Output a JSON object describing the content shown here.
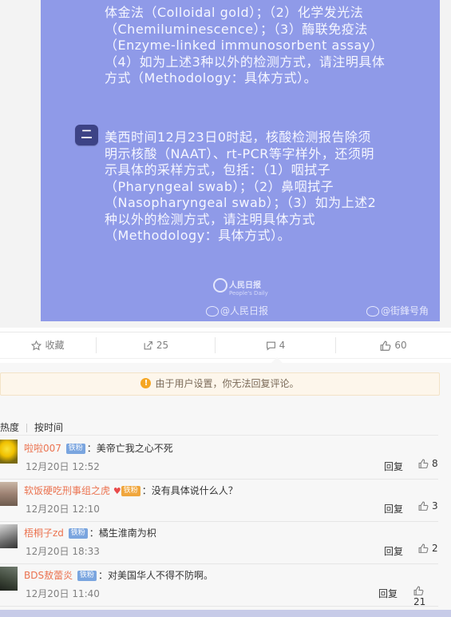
{
  "post_image": {
    "paragraph_1": "体金法（Colloidal gold）；（2）化学发光法（Chemiluminescence）；（3）酶联免疫法（Enzyme-linked immunosorbent assay）（4）如为上述3种以外的检测方式，请注明具体方式（Methodology：具体方式）。",
    "badge_2": "二",
    "paragraph_2": "美西时间12月23日0时起，核酸检测报告除须明示核酸（NAAT）、rt-PCR等字样外，还须明示具体的采样方式，包括：（1）咽拭子（Pharyngeal swab）；（2）鼻咽拭子（Nasopharyngeal swab）；（3）如为上述2种以外的检测方式，请注明具体方式（Methodology：具体方式）。",
    "logo_text": "人民日报",
    "logo_sub": "People's Daily",
    "watermark_1": "@人民日报",
    "watermark_2": "@街鋒号角"
  },
  "actions": {
    "favorite_label": "收藏",
    "repost_count": "25",
    "comment_count": "4",
    "like_count": "60"
  },
  "notice": {
    "icon": "!",
    "text": "由于用户设置，你无法回复评论。"
  },
  "sort": {
    "hot": "按热度",
    "time": "按时间"
  },
  "comments": [
    {
      "user": "啦啦007",
      "badge": "铁粉",
      "heart": "",
      "text": "：美帝亡我之心不死",
      "time": "12月20日 12:52",
      "reply": "回复",
      "likes": "8"
    },
    {
      "user": "软饭硬吃刑事组之虎",
      "badge": "铁粉",
      "heart": "♥",
      "text": "：没有具体说什么人？",
      "time": "12月20日 12:10",
      "reply": "回复",
      "likes": "3"
    },
    {
      "user": "梧桐子zd",
      "badge": "铁粉",
      "heart": "",
      "text": "：橘生淮南为枳",
      "time": "12月20日 18:33",
      "reply": "回复",
      "likes": "2"
    },
    {
      "user": "BDS敖蕾炎",
      "badge": "铁粉",
      "heart": "",
      "text": "：对美国华人不得不防啊。",
      "time": "12月20日 11:40",
      "reply": "回复",
      "likes": "21"
    }
  ],
  "colors": {
    "image_bg": "#8f9ae8",
    "username": "#eb7350",
    "fan_badge": "#7aa5df"
  }
}
